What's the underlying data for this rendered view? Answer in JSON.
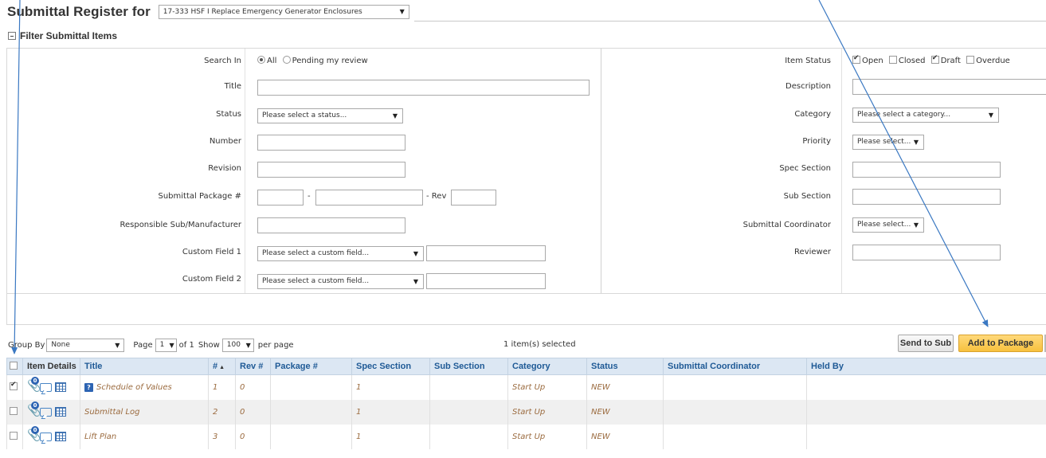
{
  "header": {
    "title": "Submittal Register for",
    "project_value": "17-333 HSF I Replace Emergency Generator Enclosures"
  },
  "filter": {
    "heading": "Filter Submittal Items",
    "left": {
      "search_in_label": "Search In",
      "search_in_all": "All",
      "search_in_pending": "Pending my review",
      "title_label": "Title",
      "status_label": "Status",
      "status_placeholder": "Please select a status...",
      "number_label": "Number",
      "revision_label": "Revision",
      "package_label": "Submittal Package #",
      "package_dash": "-",
      "package_rev": "- Rev",
      "responsible_label": "Responsible Sub/Manufacturer",
      "custom1_label": "Custom Field 1",
      "custom1_placeholder": "Please select a custom field...",
      "custom2_label": "Custom Field 2",
      "custom2_placeholder": "Please select a custom field..."
    },
    "right": {
      "item_status_label": "Item Status",
      "status_open": "Open",
      "status_closed": "Closed",
      "status_draft": "Draft",
      "status_overdue": "Overdue",
      "description_label": "Description",
      "category_label": "Category",
      "category_placeholder": "Please select a category...",
      "priority_label": "Priority",
      "priority_placeholder": "Please select...",
      "spec_section_label": "Spec Section",
      "sub_section_label": "Sub Section",
      "coordinator_label": "Submittal Coordinator",
      "coordinator_placeholder": "Please select...",
      "reviewer_label": "Reviewer"
    }
  },
  "toolbar": {
    "group_by_label": "Group By",
    "group_by_value": "None",
    "page_label": "Page",
    "page_value": "1",
    "of_label": "of 1",
    "show_label": "Show",
    "show_value": "100",
    "per_page_label": "per page",
    "selected_text": "1 item(s) selected",
    "send_to_sub": "Send to Sub",
    "add_to_package": "Add to Package"
  },
  "grid": {
    "columns": [
      "Item Details",
      "Title",
      "#",
      "Rev #",
      "Package #",
      "Spec Section",
      "Sub Section",
      "Category",
      "Status",
      "Submittal Coordinator",
      "Held By"
    ],
    "rows": [
      {
        "checked": true,
        "badge": "0",
        "title": "Schedule of Values",
        "num": "1",
        "rev": "0",
        "package": "",
        "spec": "1",
        "sub": "",
        "category": "Start Up",
        "status": "NEW",
        "coordinator": "",
        "held_by": ""
      },
      {
        "checked": false,
        "badge": "0",
        "title": "Submittal Log",
        "num": "2",
        "rev": "0",
        "package": "",
        "spec": "1",
        "sub": "",
        "category": "Start Up",
        "status": "NEW",
        "coordinator": "",
        "held_by": ""
      },
      {
        "checked": false,
        "badge": "0",
        "title": "Lift Plan",
        "num": "3",
        "rev": "0",
        "package": "",
        "spec": "1",
        "sub": "",
        "category": "Start Up",
        "status": "NEW",
        "coordinator": "",
        "held_by": ""
      }
    ]
  },
  "colors": {
    "header_bg": "#dce7f3",
    "header_text": "#1f5a96",
    "cell_text": "#9b6b3f",
    "accent_button": "#f7c13e",
    "annotation_line": "#3a78c2"
  }
}
